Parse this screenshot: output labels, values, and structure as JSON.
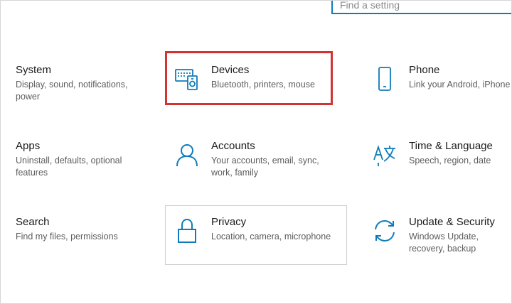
{
  "search": {
    "placeholder": "Find a setting"
  },
  "accent_color": "#0f7cba",
  "highlight_color": "#d33333",
  "tiles": [
    {
      "title": "System",
      "desc": "Display, sound, notifications, power",
      "icon": "display-icon"
    },
    {
      "title": "Devices",
      "desc": "Bluetooth, printers, mouse",
      "icon": "devices-icon"
    },
    {
      "title": "Phone",
      "desc": "Link your Android, iPhone",
      "icon": "phone-icon"
    },
    {
      "title": "Apps",
      "desc": "Uninstall, defaults, optional features",
      "icon": "apps-icon"
    },
    {
      "title": "Accounts",
      "desc": "Your accounts, email, sync, work, family",
      "icon": "person-icon"
    },
    {
      "title": "Time & Language",
      "desc": "Speech, region, date",
      "icon": "time-language-icon"
    },
    {
      "title": "Search",
      "desc": "Find my files, permissions",
      "icon": "search-icon"
    },
    {
      "title": "Privacy",
      "desc": "Location, camera, microphone",
      "icon": "lock-icon"
    },
    {
      "title": "Update & Security",
      "desc": "Windows Update, recovery, backup",
      "icon": "sync-icon"
    }
  ]
}
